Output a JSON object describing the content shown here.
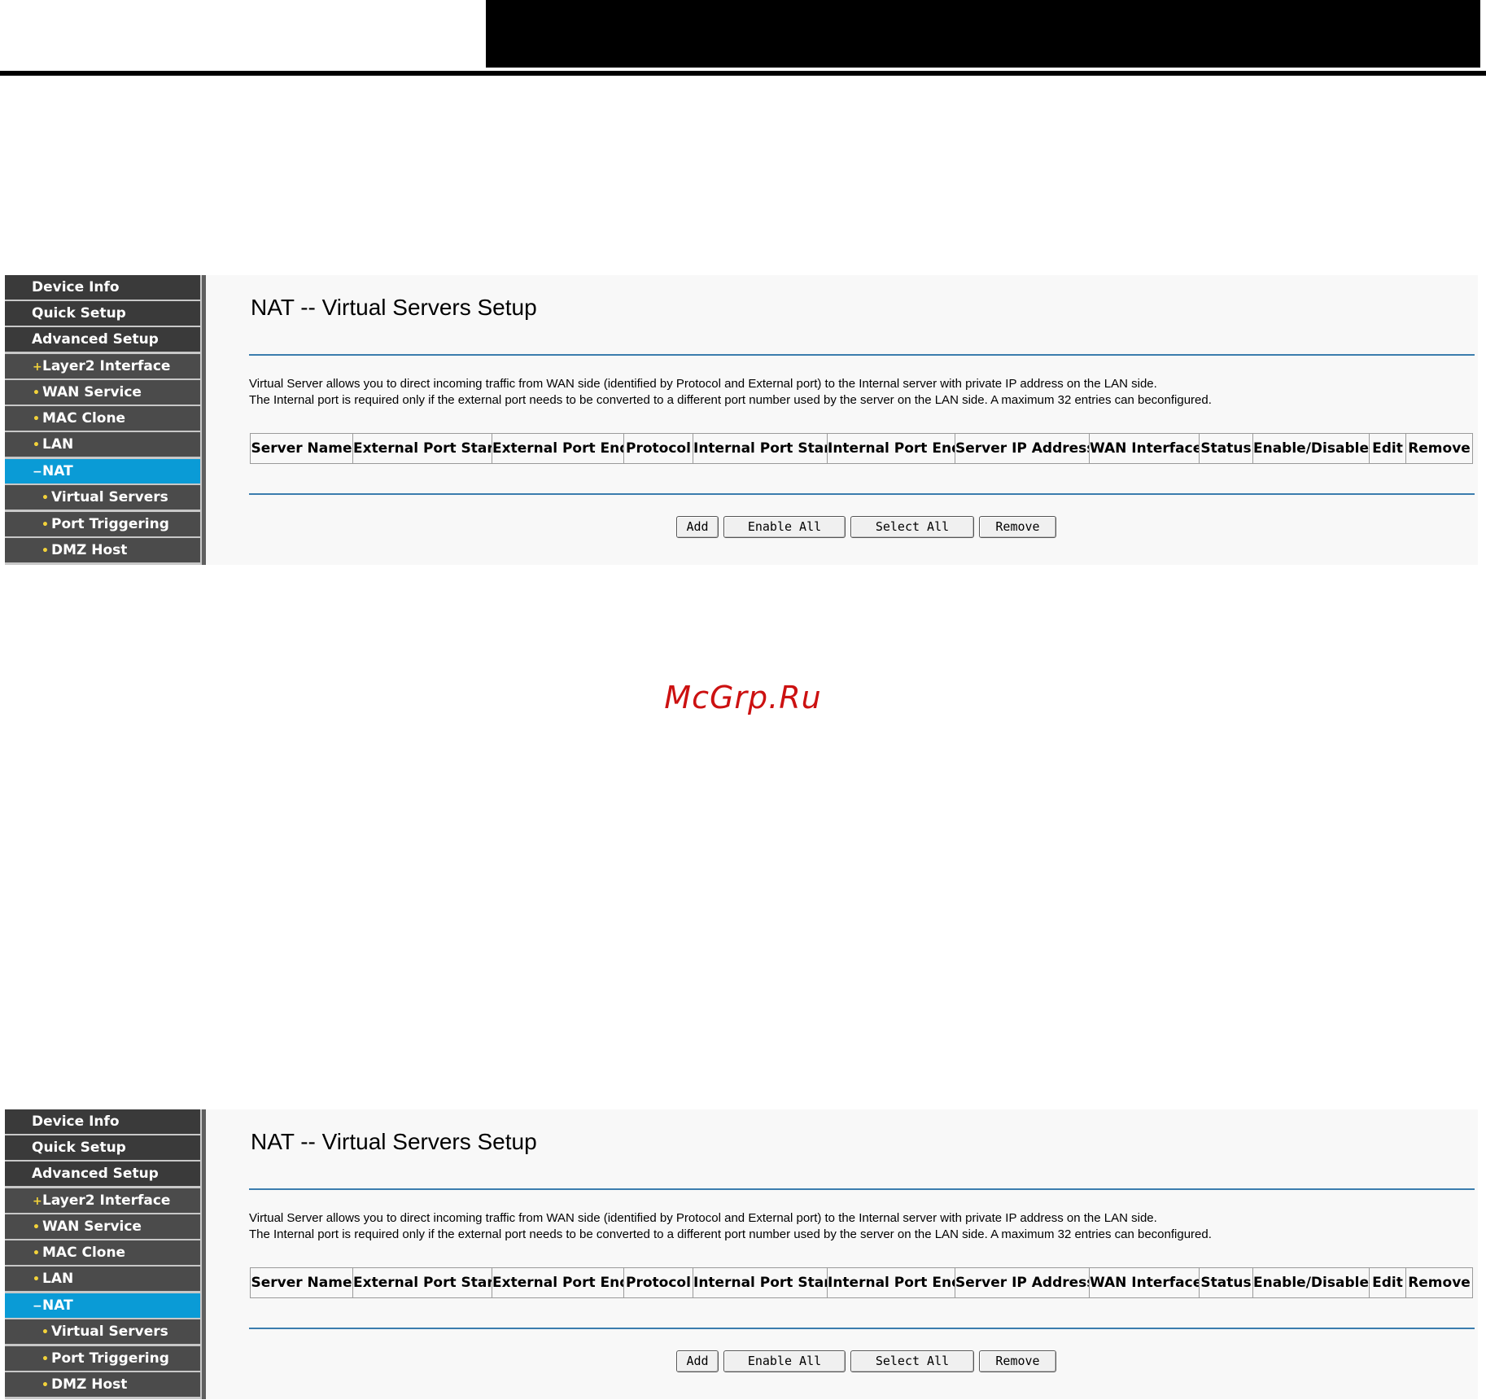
{
  "watermark": "McGrp.Ru",
  "panels": [
    {
      "sidebar": [
        "Device Info",
        "Quick Setup",
        "Advanced Setup",
        "Layer2 Interface",
        "WAN Service",
        "MAC Clone",
        "LAN",
        "NAT",
        "Virtual Servers",
        "Port Triggering",
        "DMZ Host"
      ],
      "sidebar_markers": {
        "Layer2 Interface": "+",
        "NAT": "−",
        "default": "•"
      },
      "title": "NAT -- Virtual Servers Setup",
      "description": [
        "Virtual Server allows you to direct incoming traffic from WAN side (identified by Protocol and External port) to the Internal server with private IP address on the LAN side.",
        "The Internal port is required only if the external port needs to be converted to a different port number used by the server on the LAN side. A maximum 32 entries can beconfigured."
      ],
      "table_headers": [
        "Server Name",
        "External Port Start",
        "External Port End",
        "Protocol",
        "Internal Port Start",
        "Internal Port End",
        "Server IP Address",
        "WAN Interface",
        "Status",
        "Enable/Disable",
        "Edit",
        "Remove"
      ],
      "buttons": [
        "Add",
        "Enable All",
        "Select All",
        "Remove"
      ]
    },
    {
      "sidebar": [
        "Device Info",
        "Quick Setup",
        "Advanced Setup",
        "Layer2 Interface",
        "WAN Service",
        "MAC Clone",
        "LAN",
        "NAT",
        "Virtual Servers",
        "Port Triggering",
        "DMZ Host"
      ],
      "sidebar_markers": {
        "Layer2 Interface": "+",
        "NAT": "−",
        "default": "•"
      },
      "title": "NAT -- Virtual Servers Setup",
      "description": [
        "Virtual Server allows you to direct incoming traffic from WAN side (identified by Protocol and External port) to the Internal server with private IP address on the LAN side.",
        "The Internal port is required only if the external port needs to be converted to a different port number used by the server on the LAN side. A maximum 32 entries can beconfigured."
      ],
      "table_headers": [
        "Server Name",
        "External Port Start",
        "External Port End",
        "Protocol",
        "Internal Port Start",
        "Internal Port End",
        "Server IP Address",
        "WAN Interface",
        "Status",
        "Enable/Disable",
        "Edit",
        "Remove"
      ],
      "buttons": [
        "Add",
        "Enable All",
        "Select All",
        "Remove"
      ]
    }
  ],
  "colors": {
    "sidebar_bg": "#4b4b4b",
    "sidebar_active": "#0a9bd6",
    "rule": "#3b7dae",
    "watermark": "#cc1111"
  }
}
